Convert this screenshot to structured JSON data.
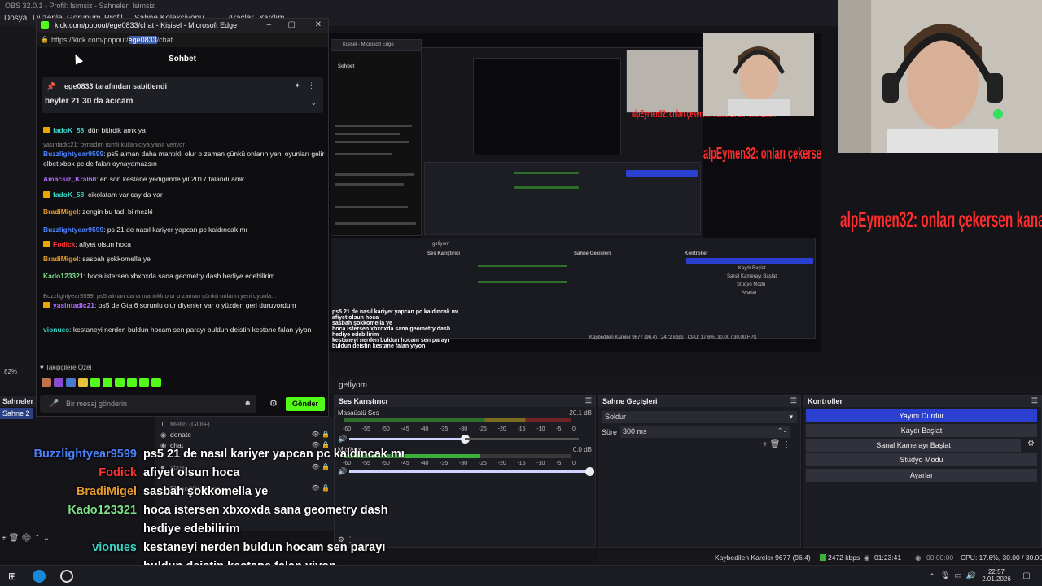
{
  "obs": {
    "title": "OBS 32.0.1 - Profil: İsimsiz - Sahneler: İsimsiz",
    "menu": [
      "Dosya",
      "Düzenle",
      "Görünüm",
      "Profil",
      "Sahne Koleksiyonu",
      "Araçlar",
      "Yardım"
    ],
    "scenes_header": "Sahneler",
    "scene_item": "Sahne 2",
    "scene_tab": "gelİyom",
    "zoom": "82%",
    "sources": [
      "Metin (GDI+)",
      "donate",
      "chat",
      "xbox",
      "Ekran Yakalama"
    ],
    "audio": {
      "header": "Ses Karıştırıcı",
      "desktop_label": "Masaüstü Ses",
      "desktop_db": "-20.1 dB",
      "mic_label": "Mic/Aux",
      "mic_db": "0.0 dB",
      "ticks": [
        "-60",
        "-55",
        "-50",
        "-45",
        "-40",
        "-35",
        "-30",
        "-25",
        "-20",
        "-15",
        "-10",
        "-5",
        "0"
      ]
    },
    "transitions": {
      "header": "Sahne Geçişleri",
      "type": "Soldur",
      "duration_label": "Süre",
      "duration_value": "300 ms"
    },
    "controls": {
      "header": "Kontroller",
      "buttons": [
        "Yayını Durdur",
        "Kaydı Başlat",
        "Sanal Kamerayı Başlat",
        "Stüdyo Modu",
        "Ayarlar"
      ]
    },
    "status": {
      "dropped": "Kaybedilen Kareler 9677 (96.4)",
      "bitrate": "2472 kbps",
      "live_time": "01:23:41",
      "rec_time": "00:00:00",
      "cpu": "CPU: 17.6%, 30.00 / 30.00 FPS"
    }
  },
  "edge": {
    "title": "kick.com/popout/ege0833/chat - Kişisel - Microsoft Edge",
    "url_prefix": "https://kick.com/popout/",
    "url_selected": "ege0833",
    "url_suffix": "/chat",
    "chat_header": "Sohbet",
    "pinned_by": "ege0833 tarafından sabitlendi",
    "pinned_msg": "beyler 21 30 da acıcam",
    "messages": [
      {
        "user": "fadoK_58",
        "color": "#3bd4c8",
        "text": "dün bitirdik amk ya",
        "badge": true
      },
      {
        "reply": "yasintadic21: oynadım isimli kullanıcıya yanıt veriyor"
      },
      {
        "user": "Buzzlightyear9599",
        "color": "#4d82ff",
        "text": "ps5 alman daha mantıklı olur o zaman çünkü onların yeni oyunları gelir elbet xbox pc de falan oynayamazsın"
      },
      {
        "user": "Amacsiz_Kral60",
        "color": "#b06dff",
        "text": "en son kestane yediğimde yıl 2017 falandı amk"
      },
      {
        "user": "fadoK_58",
        "color": "#3bd4c8",
        "text": "cikolatam var cay da var",
        "badge": true
      },
      {
        "user": "BradiMigel",
        "color": "#e69a2e",
        "text": "zengin bu tadı bilmezki"
      },
      {
        "user": "Buzzlightyear9599",
        "color": "#4d82ff",
        "text": "ps 21 de nasıl kariyer yapcan pc kaldıncak mı"
      },
      {
        "user": "Fodick",
        "color": "#ff3434",
        "text": "afiyet olsun hoca",
        "badge": true
      },
      {
        "user": "BradiMigel",
        "color": "#e69a2e",
        "text": "sasbah şokkomella ye"
      },
      {
        "user": "Kado123321",
        "color": "#7fe08a",
        "text": "hoca istersen xbxoxda sana geometry dash hediye edebilirim"
      },
      {
        "reply": "Buzzlightyear9599: ps5 alman daha mantıklı olur o zaman çünkü onların yeni oyunla..."
      },
      {
        "user": "yasintadic21",
        "color": "#b06dff",
        "text": "ps5 de Gta 6 sorunlu olur diyenler var o yüzden geri duruyordum",
        "badge": true
      },
      {
        "user": "vionues",
        "color": "#3bd4c8",
        "text": "kestaneyi nerden buldun hocam sen parayı buldun deistin kestane falan yiyon"
      }
    ],
    "followers_label": "Takipçilere Özel",
    "input_placeholder": "Bir mesaj gönderin",
    "send_label": "Gönder"
  },
  "overlay_chat": [
    {
      "user": "Buzzlightyear9599",
      "color": "#4d82ff",
      "text": "ps5 21 de nasıl kariyer yapcan pc kaldıncak mı"
    },
    {
      "user": "Fodick",
      "color": "#ff3434",
      "text": "afiyet olsun hoca"
    },
    {
      "user": "BradiMigel",
      "color": "#e69a2e",
      "text": "sasbah şokkomella ye"
    },
    {
      "user": "Kado123321",
      "color": "#7fe08a",
      "text": "hoca istersen xbxoxda sana geometry dash"
    },
    {
      "user": "",
      "color": "#7fe08a",
      "text": "hediye edebilirim"
    },
    {
      "user": "vionues",
      "color": "#3bd4c8",
      "text": "kestaneyi nerden buldun hocam sen parayı"
    },
    {
      "user": "",
      "color": "#3bd4c8",
      "text": "buldun deistin kestane falan yiyon"
    }
  ],
  "donation_overlay": "alpEymen32: onları çekersen kanal 10 bin olur zaten",
  "taskbar": {
    "time": "22:57",
    "date": "2.01.2026"
  }
}
